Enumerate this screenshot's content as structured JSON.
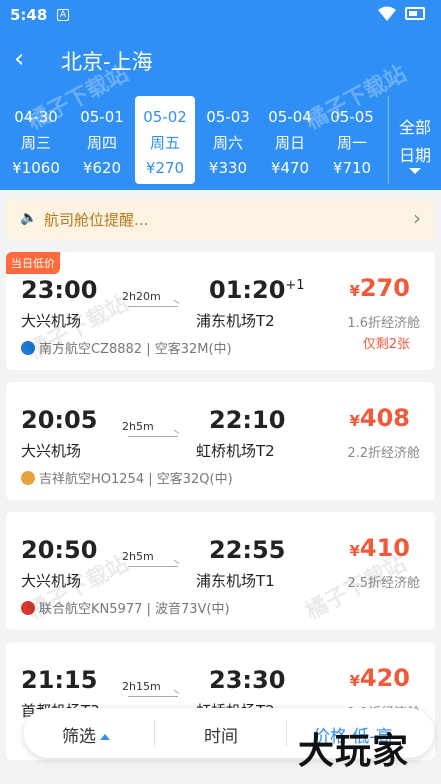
{
  "status_bar": {
    "time": "5:48",
    "sim_label": "A"
  },
  "nav": {
    "back_icon": "‹",
    "title": "北京-上海"
  },
  "dates": [
    {
      "date": "04-30",
      "weekday": "周三",
      "price": "¥1060"
    },
    {
      "date": "05-01",
      "weekday": "周四",
      "price": "¥620"
    },
    {
      "date": "05-02",
      "weekday": "周五",
      "price": "¥270",
      "active": true
    },
    {
      "date": "05-03",
      "weekday": "周六",
      "price": "¥330"
    },
    {
      "date": "05-04",
      "weekday": "周日",
      "price": "¥470"
    },
    {
      "date": "05-05",
      "weekday": "周一",
      "price": "¥710"
    }
  ],
  "all_dates": {
    "line1": "全部",
    "line2": "日期"
  },
  "notice": {
    "text": "航司舱位提醒..."
  },
  "flights": [
    {
      "badge": "当日低价",
      "dep_time": "23:00",
      "arr_time": "01:20",
      "day_offset": "+1",
      "duration": "2h20m",
      "from": "大兴机场",
      "to": "浦东机场T2",
      "yen": "¥",
      "price": "270",
      "cabin": "1.6折经济舱",
      "seats_left": "仅剩2张",
      "airline": "南方航空CZ8882 | 空客32M(中)",
      "airline_color": "#1a7bd6"
    },
    {
      "dep_time": "20:05",
      "arr_time": "22:10",
      "duration": "2h5m",
      "from": "大兴机场",
      "to": "虹桥机场T2",
      "yen": "¥",
      "price": "408",
      "cabin": "2.2折经济舱",
      "airline": "吉祥航空HO1254 | 空客32Q(中)",
      "airline_color": "#e8a23c"
    },
    {
      "dep_time": "20:50",
      "arr_time": "22:55",
      "duration": "2h5m",
      "from": "大兴机场",
      "to": "浦东机场T1",
      "yen": "¥",
      "price": "410",
      "cabin": "2.5折经济舱",
      "airline": "联合航空KN5977 | 波音73V(中)",
      "airline_color": "#d63a2f"
    },
    {
      "dep_time": "21:15",
      "arr_time": "23:30",
      "duration": "2h15m",
      "from": "首都机场T3",
      "to": "虹桥机场T2",
      "yen": "¥",
      "price": "420",
      "cabin": "1.9折经济舱",
      "airline": "",
      "airline_color": "#1a7bd6"
    }
  ],
  "filter_bar": {
    "filter": "筛选",
    "time": "时间",
    "price_sort": "价格 低-高"
  },
  "watermark": "橘子下载站",
  "corner_logo": "大玩家",
  "colors": {
    "primary": "#2f8ff5",
    "price": "#f05a3a",
    "badge": "#fe6a3b"
  }
}
